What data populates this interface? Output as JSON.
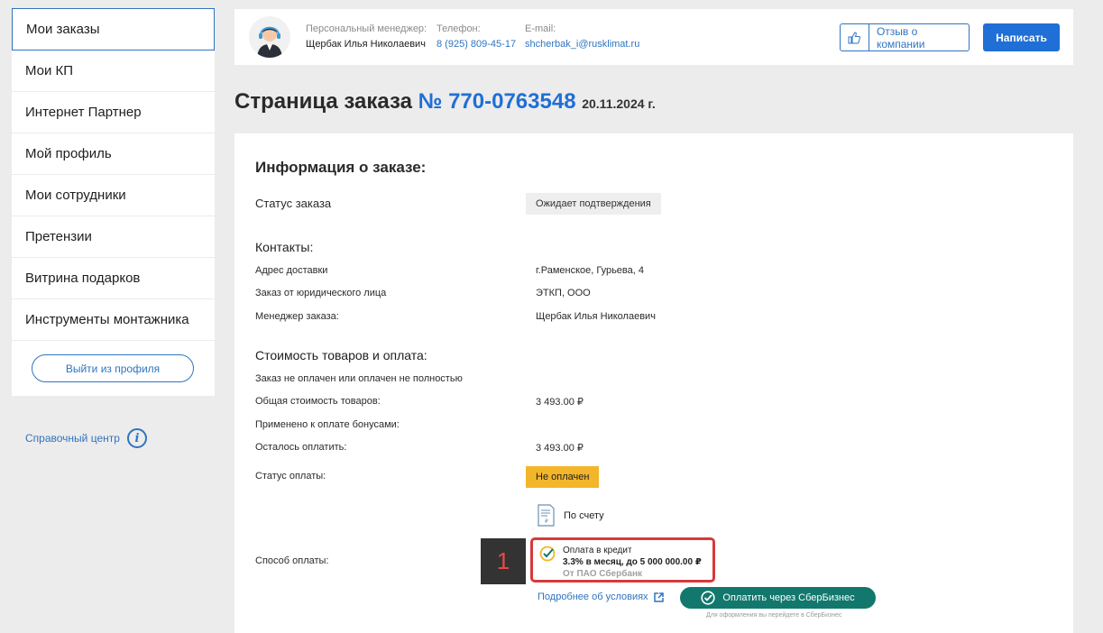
{
  "sidebar": {
    "items": [
      {
        "label": "Мои заказы"
      },
      {
        "label": "Мои КП"
      },
      {
        "label": "Интернет Партнер"
      },
      {
        "label": "Мой профиль"
      },
      {
        "label": "Мои сотрудники"
      },
      {
        "label": "Претензии"
      },
      {
        "label": "Витрина подарков"
      },
      {
        "label": "Инструменты монтажника"
      }
    ],
    "logout_label": "Выйти из профиля",
    "help_label": "Справочный центр"
  },
  "manager": {
    "title_label": "Персональный менеджер:",
    "name": "Щербак Илья Николаевич",
    "phone_label": "Телефон:",
    "phone": "8 (925) 809-45-17",
    "email_label": "E-mail:",
    "email": "shcherbak_i@rusklimat.ru",
    "review_label": "Отзыв о компании",
    "write_label": "Написать"
  },
  "page": {
    "title_prefix": "Страница заказа",
    "order_number": "№ 770-0763548",
    "date": "20.11.2024 г."
  },
  "order": {
    "heading": "Информация о заказе:",
    "status_label": "Статус заказа",
    "status_value": "Ожидает подтверждения",
    "contacts_heading": "Контакты:",
    "address_label": "Адрес доставки",
    "address_value": "г.Раменское, Гурьева, 4",
    "legal_label": "Заказ от юридического лица",
    "legal_value": "ЭТКП, ООО",
    "manager_label": "Менеджер заказа:",
    "manager_value": "Щербак Илья Николаевич",
    "cost_heading": "Стоимость товаров и оплата:",
    "paid_note": "Заказ не оплачен или оплачен не полностью",
    "total_label": "Общая стоимость товаров:",
    "total_value": "3 493.00 ₽",
    "bonus_label": "Применено к оплате бонусами:",
    "remaining_label": "Осталось оплатить:",
    "remaining_value": "3 493.00 ₽",
    "pay_status_label": "Статус оплаты:",
    "pay_status_value": "Не оплачен",
    "pay_method_label": "Способ оплаты:",
    "invoice_label": "По счету",
    "credit_title": "Оплата в кредит",
    "credit_terms": "3.3% в месяц, до 5 000 000.00 ₽",
    "credit_bank": "От ПАО Сбербанк",
    "details_link": "Подробнее об условиях",
    "sber_button": "Оплатить через СберБизнес",
    "sber_note": "Для оформления вы перейдете в СберБизнес"
  },
  "annotation": {
    "marker": "1"
  },
  "colors": {
    "accent": "#1f6fd6",
    "unpaid": "#f3b52a",
    "sber": "#12786d",
    "highlight": "#d63a3a"
  }
}
